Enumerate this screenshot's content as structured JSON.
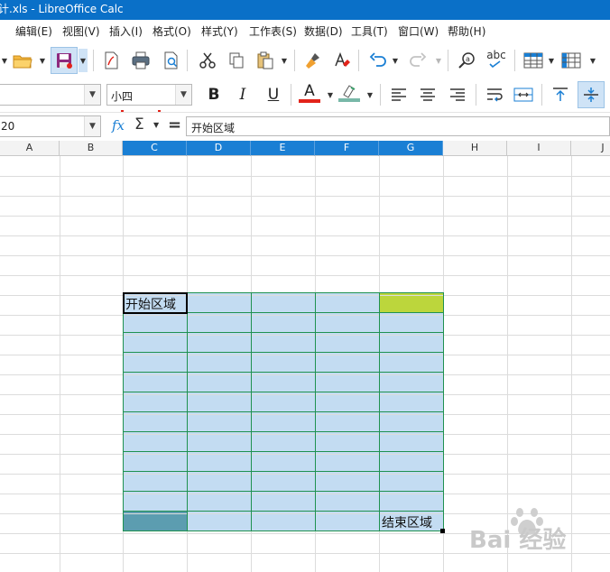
{
  "window": {
    "title": "计.xls - LibreOffice Calc"
  },
  "menu": [
    "编辑(E)",
    "视图(V)",
    "插入(I)",
    "格式(O)",
    "样式(Y)",
    "工作表(S)",
    "数据(D)",
    "工具(T)",
    "窗口(W)",
    "帮助(H)"
  ],
  "toolbar": {
    "font_size_value": "小四",
    "font_name_value": "",
    "bold_label": "B",
    "italic_label": "I",
    "underline_label": "U",
    "font_color_label": "A",
    "spelling_label": "abc"
  },
  "formula_bar": {
    "name_box_value": "20",
    "fx_label": "fx",
    "sum_label": "Σ",
    "equals_label": "=",
    "content": "开始区域"
  },
  "sheet": {
    "columns": [
      "A",
      "B",
      "C",
      "D",
      "E",
      "F",
      "G",
      "H",
      "I",
      "J"
    ],
    "selected_columns": [
      "C",
      "D",
      "E",
      "F",
      "G"
    ],
    "start_cell_text": "开始区域",
    "end_cell_text": "结束区域"
  },
  "colors": {
    "title_bar": "#0a70c8",
    "selection_fill": "#c3dcf2",
    "range_lines": "#1f9150",
    "marker_green": "#bcd63c",
    "marker_teal": "#5c9db0",
    "print_highlight": "#e2231a"
  },
  "watermark": {
    "text": "Bai 经验"
  }
}
